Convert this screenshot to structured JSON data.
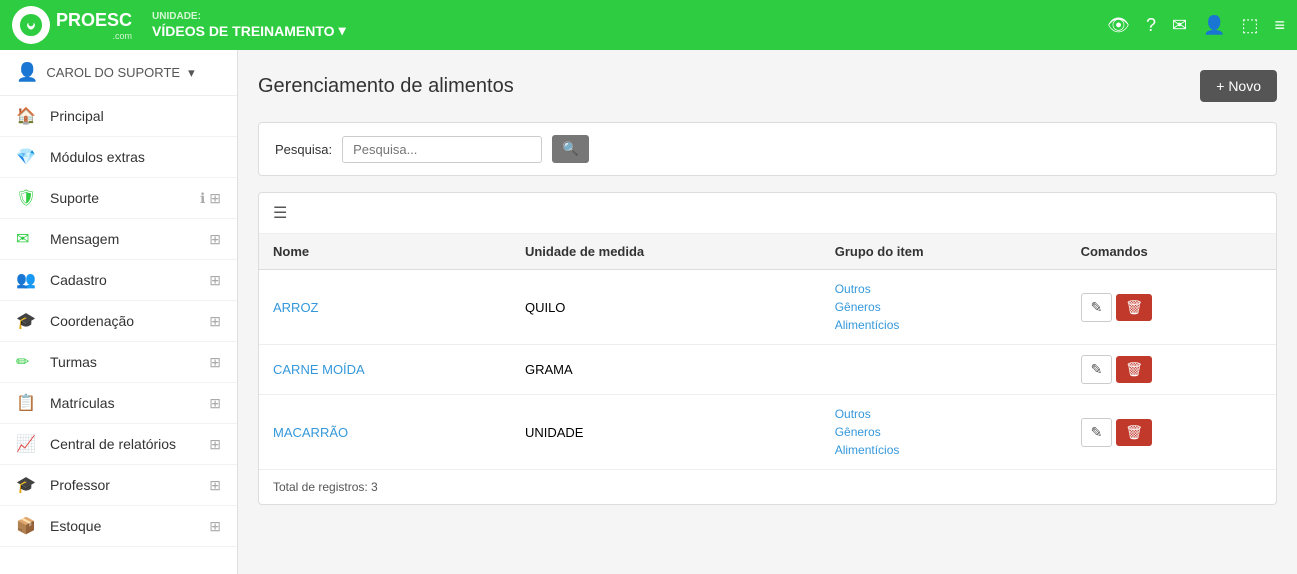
{
  "topnav": {
    "logo_text": "PROESC",
    "logo_sub": ".com",
    "unit_label": "UNIDADE:",
    "unit_name": "VÍDEOS DE TREINAMENTO",
    "unit_chevron": "▾",
    "icons": [
      "👁",
      "?",
      "✉",
      "👤",
      "⬚",
      "≡"
    ]
  },
  "sidebar": {
    "user_name": "CAROL DO SUPORTE",
    "user_chevron": "▾",
    "items": [
      {
        "id": "principal",
        "label": "Principal",
        "icon": "🏠",
        "color": "green",
        "has_add": false
      },
      {
        "id": "modulos",
        "label": "Módulos extras",
        "icon": "💎",
        "color": "blue",
        "has_add": false
      },
      {
        "id": "suporte",
        "label": "Suporte",
        "icon": "🛡",
        "color": "green",
        "has_add": true,
        "has_info": true
      },
      {
        "id": "mensagem",
        "label": "Mensagem",
        "icon": "✉",
        "color": "green",
        "has_add": true
      },
      {
        "id": "cadastro",
        "label": "Cadastro",
        "icon": "👥",
        "color": "green",
        "has_add": true
      },
      {
        "id": "coordenacao",
        "label": "Coordenação",
        "icon": "🎓",
        "color": "green",
        "has_add": true
      },
      {
        "id": "turmas",
        "label": "Turmas",
        "icon": "✏",
        "color": "green",
        "has_add": true
      },
      {
        "id": "matriculas",
        "label": "Matrículas",
        "icon": "📋",
        "color": "green",
        "has_add": true
      },
      {
        "id": "relatorios",
        "label": "Central de relatórios",
        "icon": "📈",
        "color": "green",
        "has_add": true
      },
      {
        "id": "professor",
        "label": "Professor",
        "icon": "🎓",
        "color": "green",
        "has_add": true
      },
      {
        "id": "estoque",
        "label": "Estoque",
        "icon": "📦",
        "color": "green",
        "has_add": true
      }
    ]
  },
  "main": {
    "page_title": "Gerenciamento de alimentos",
    "btn_novo": "+ Novo",
    "search": {
      "label": "Pesquisa:",
      "placeholder": "Pesquisa..."
    },
    "table": {
      "col_nome": "Nome",
      "col_unidade": "Unidade de medida",
      "col_grupo": "Grupo do item",
      "col_comandos": "Comandos",
      "rows": [
        {
          "nome": "ARROZ",
          "unidade": "QUILO",
          "grupo": "Outros\nGêneros\nAlimentícios"
        },
        {
          "nome": "CARNE MOÍDA",
          "unidade": "GRAMA",
          "grupo": ""
        },
        {
          "nome": "MACARRÃO",
          "unidade": "UNIDADE",
          "grupo": "Outros\nGêneros\nAlimentícios"
        }
      ],
      "footer": "Total de registros: 3"
    }
  }
}
